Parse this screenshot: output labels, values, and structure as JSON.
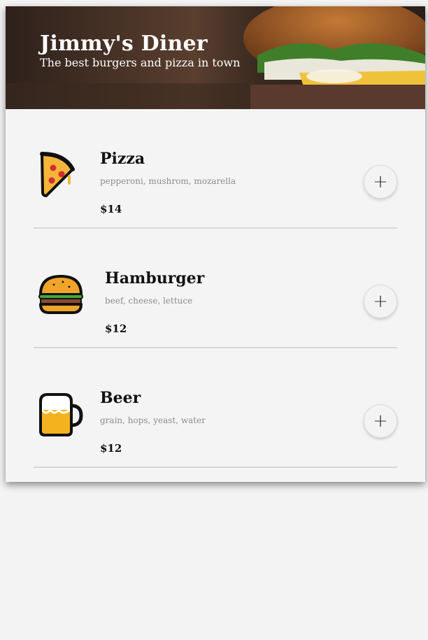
{
  "header": {
    "title": "Jimmy's Diner",
    "subtitle": "The best burgers and pizza in town"
  },
  "menu": {
    "items": [
      {
        "name": "Pizza",
        "ingredients": "pepperoni, mushrom, mozarella",
        "price": "$14",
        "icon": "pizza-icon",
        "add_label": "+"
      },
      {
        "name": "Hamburger",
        "ingredients": "beef, cheese, lettuce",
        "price": "$12",
        "icon": "hamburger-icon",
        "add_label": "+"
      },
      {
        "name": "Beer",
        "ingredients": "grain, hops, yeast, water",
        "price": "$12",
        "icon": "beer-icon",
        "add_label": "+"
      }
    ]
  }
}
